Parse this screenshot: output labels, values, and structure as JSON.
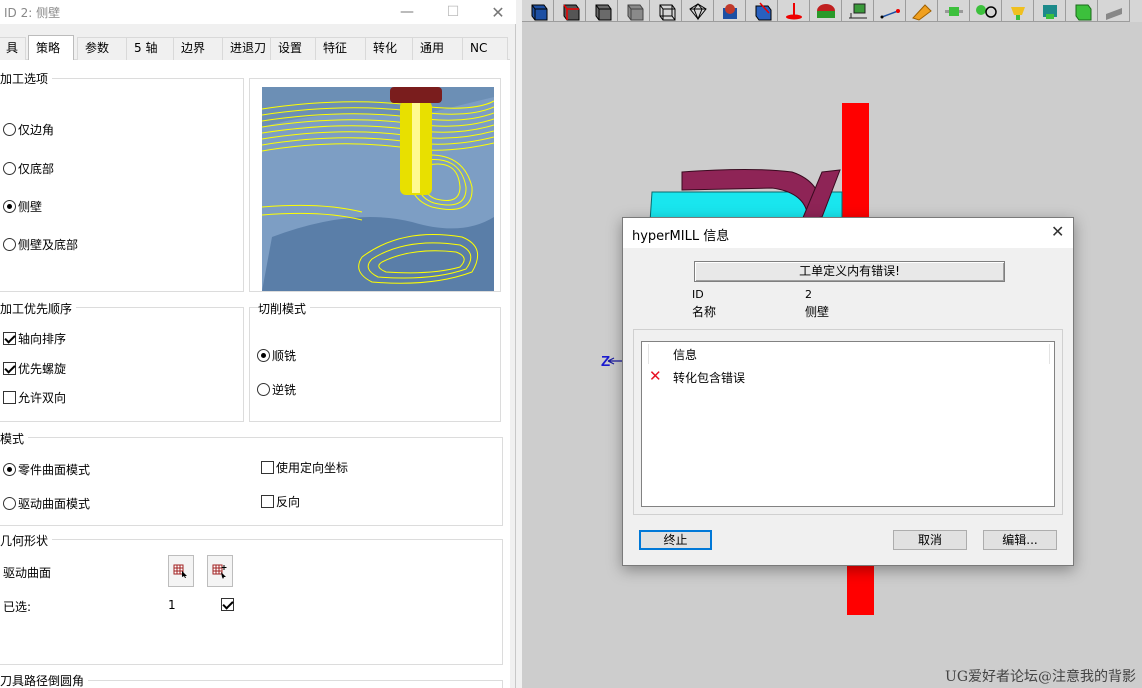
{
  "job_window": {
    "title": "ID 2: 侧壁",
    "tabs": [
      "具",
      "策略",
      "参数",
      "5 轴",
      "边界",
      "进退刀",
      "设置",
      "特征",
      "转化",
      "通用",
      "NC"
    ],
    "active_tab": "策略",
    "machining_options": {
      "label": "加工选项",
      "options": [
        "仅边角",
        "仅底部",
        "侧壁",
        "侧壁及底部"
      ],
      "selected": "侧壁"
    },
    "machining_priority": {
      "label": "加工优先顺序",
      "items": [
        {
          "label": "轴向排序",
          "checked": true
        },
        {
          "label": "优先螺旋",
          "checked": true
        },
        {
          "label": "允许双向",
          "checked": false
        }
      ]
    },
    "cut_mode": {
      "label": "切削模式",
      "options": [
        "顺铣",
        "逆铣"
      ],
      "selected": "顺铣"
    },
    "mode": {
      "label": "模式",
      "radios": [
        "零件曲面模式",
        "驱动曲面模式"
      ],
      "selected": "零件曲面模式",
      "checks": [
        {
          "label": "使用定向坐标",
          "checked": false
        },
        {
          "label": "反向",
          "checked": false
        }
      ]
    },
    "geometry": {
      "label": "几何形状",
      "drive_surface_label": "驱动曲面",
      "selected_label": "已选:",
      "selected_count": "1",
      "selected_checked": true
    },
    "next_group_label": "刀具路径倒圆角"
  },
  "info_dialog": {
    "title": "hyperMILL 信息",
    "banner": "工单定义内有错误!",
    "id_label": "ID",
    "id_value": "2",
    "name_label": "名称",
    "name_value": "侧壁",
    "list_header": "信息",
    "messages": [
      {
        "icon": "error-x-icon",
        "text": "转化包含错误"
      }
    ],
    "buttons": {
      "abort": "终止",
      "cancel": "取消",
      "edit": "编辑..."
    }
  },
  "viewport": {
    "axis_label": "Z",
    "watermark": "UG爱好者论坛@注意我的背影"
  },
  "colors": {
    "accent": "#0078d7",
    "error": "#e81123",
    "viewport_bg": "#cdcdcd",
    "part_cyan": "#19e6ee",
    "fixture_red": "#ff0000",
    "rib_purple": "#8e2456",
    "toolpath_yellow": "#ffff00"
  }
}
